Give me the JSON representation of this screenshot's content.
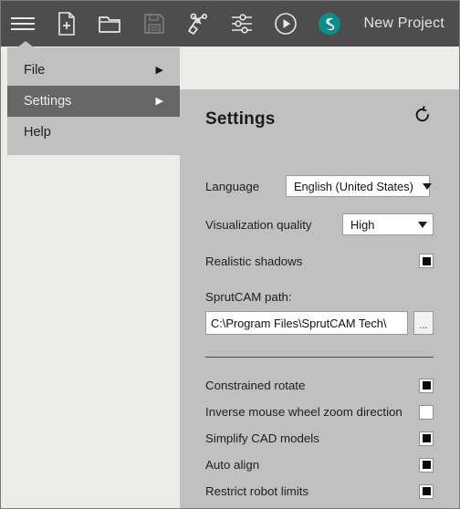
{
  "window": {
    "title": "New Project"
  },
  "toolbar": {
    "title": "New Project",
    "buttons": [
      {
        "name": "main-menu-button",
        "icon": "hamburger-menu-icon",
        "label": "Menu"
      },
      {
        "name": "new-file-button",
        "icon": "new-document-icon",
        "label": "New"
      },
      {
        "name": "open-file-button",
        "icon": "open-folder-icon",
        "label": "Open"
      },
      {
        "name": "save-file-button",
        "icon": "floppy-save-icon",
        "label": "Save"
      },
      {
        "name": "robot-setup-button",
        "icon": "robot-arm-icon",
        "label": "Robot"
      },
      {
        "name": "parameters-button",
        "icon": "sliders-icon",
        "label": "Parameters"
      },
      {
        "name": "simulate-button",
        "icon": "play-circle-icon",
        "label": "Simulate"
      },
      {
        "name": "sprutcam-logo-button",
        "icon": "sprutcam-logo-icon",
        "label": "SprutCAM"
      }
    ]
  },
  "menu": {
    "items": [
      {
        "label": "File",
        "has_submenu": true,
        "arrow": "▶",
        "active": false
      },
      {
        "label": "Settings",
        "has_submenu": true,
        "arrow": "▶",
        "active": true
      },
      {
        "label": "Help",
        "has_submenu": false,
        "arrow": "",
        "active": false
      }
    ]
  },
  "settings": {
    "title": "Settings",
    "reset_icon": "reset-arrow-icon",
    "language": {
      "label": "Language",
      "value": "English (United States)"
    },
    "visualization_quality": {
      "label": "Visualization quality",
      "value": "High"
    },
    "realistic_shadows": {
      "label": "Realistic shadows",
      "checked": true
    },
    "sprutcam_path": {
      "label": "SprutCAM path:",
      "value": "C:\\Program Files\\SprutCAM Tech\\",
      "placeholder": "",
      "browse_label": "..."
    },
    "options": [
      {
        "label": "Constrained rotate",
        "checked": true,
        "name": "checkbox-constrained-rotate"
      },
      {
        "label": "Inverse mouse wheel zoom direction",
        "checked": false,
        "name": "checkbox-inverse-mouse-wheel-zoom"
      },
      {
        "label": "Simplify CAD models",
        "checked": true,
        "name": "checkbox-simplify-cad-models"
      },
      {
        "label": "Auto align",
        "checked": true,
        "name": "checkbox-auto-align"
      },
      {
        "label": "Restrict robot limits",
        "checked": true,
        "name": "checkbox-restrict-robot-limits"
      }
    ]
  },
  "colors": {
    "toolbar_bg": "#4d4d4d",
    "panel_bg": "#c0c0c0",
    "page_bg": "#ececeb",
    "menu_active_bg": "#666666",
    "brand_teal": "#0f8a8a"
  }
}
